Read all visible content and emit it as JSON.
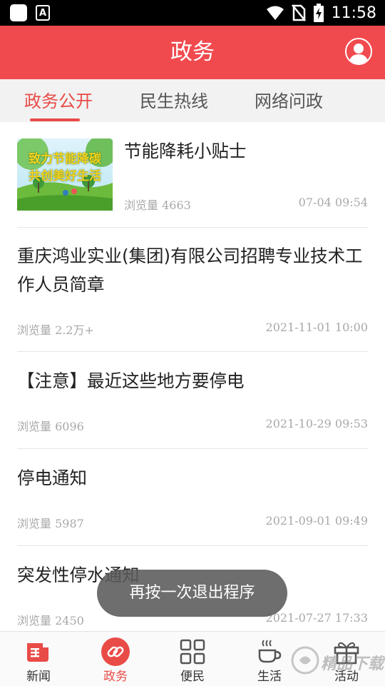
{
  "status_bar": {
    "time": "11:58"
  },
  "header": {
    "title": "政务"
  },
  "tabs": [
    {
      "label": "政务公开",
      "active": true
    },
    {
      "label": "民生热线",
      "active": false
    },
    {
      "label": "网络问政",
      "active": false
    }
  ],
  "articles": [
    {
      "title": "节能降耗小贴士",
      "views": "浏览量 4663",
      "date": "07-04 09:54",
      "thumbnail": {
        "line1": "致力节能降碳",
        "line2": "共创美好生活"
      }
    },
    {
      "title": "重庆鸿业实业(集团)有限公司招聘专业技术工作人员简章",
      "views": "浏览量 2.2万+",
      "date": "2021-11-01 10:00"
    },
    {
      "title": "【注意】最近这些地方要停电",
      "views": "浏览量 6096",
      "date": "2021-10-29 09:53"
    },
    {
      "title": "停电通知",
      "views": "浏览量 5987",
      "date": "2021-09-01 09:49"
    },
    {
      "title": "突发性停水通知",
      "views": "浏览量 2450",
      "date": "2021-07-27 17:33"
    }
  ],
  "toast": {
    "text": "再按一次退出程序"
  },
  "bottom_nav": [
    {
      "label": "新闻",
      "icon": "newspaper-icon",
      "active": false
    },
    {
      "label": "政务",
      "icon": "link-icon",
      "active": true
    },
    {
      "label": "便民",
      "icon": "grid-icon",
      "active": false
    },
    {
      "label": "生活",
      "icon": "coffee-icon",
      "active": false
    },
    {
      "label": "活动",
      "icon": "gift-icon",
      "active": false
    }
  ],
  "watermark": {
    "text": "精品下载"
  },
  "colors": {
    "brand_red": "#f04a4f",
    "accent": "#e94b47",
    "meta_gray": "#a8a8a8"
  }
}
